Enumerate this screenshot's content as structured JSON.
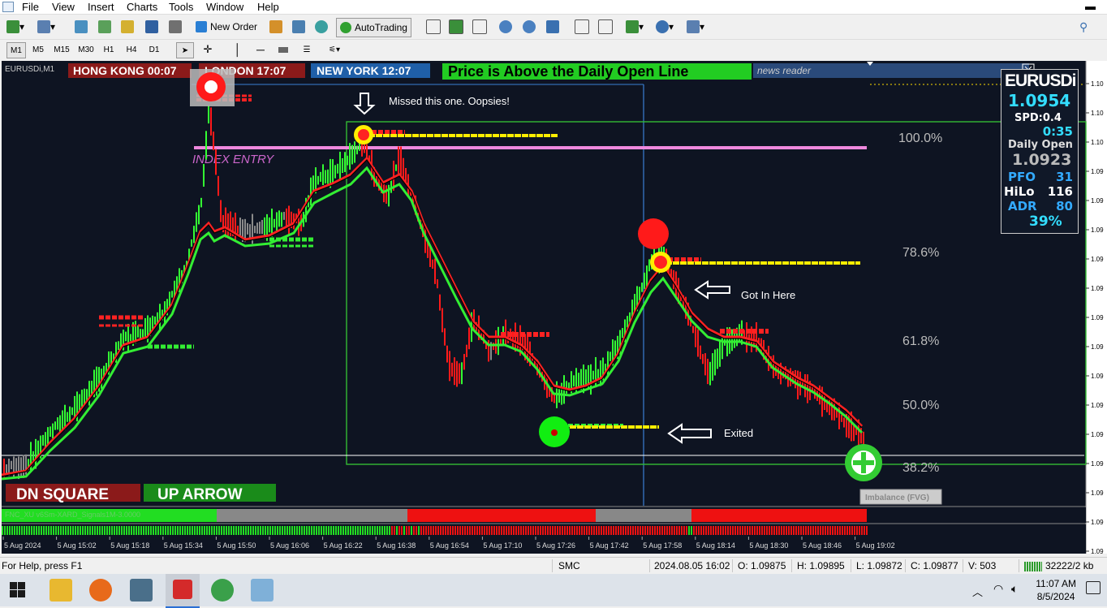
{
  "menu": [
    "File",
    "View",
    "Insert",
    "Charts",
    "Tools",
    "Window",
    "Help"
  ],
  "toolbar": {
    "new_order": "New Order",
    "auto_trading": "AutoTrading"
  },
  "timeframes": [
    "M1",
    "M5",
    "M15",
    "M30",
    "H1",
    "H4",
    "D1"
  ],
  "active_timeframe": "M1",
  "chart": {
    "symbol_tab": "EURUSDi,M1",
    "sessions": [
      {
        "label": "HONG KONG 00:07",
        "color": "#8b1a1a"
      },
      {
        "label": "LONDON  17:07",
        "color": "#8b1a1a"
      },
      {
        "label": "NEW YORK  12:07",
        "color": "#1f5fa8"
      }
    ],
    "banner": "Price is Above the Daily Open Line",
    "news_reader": "news reader",
    "index_entry": "INDEX ENTRY",
    "annotations": {
      "missed": "Missed this one.  Oopsies!",
      "got_in": "Got In Here",
      "exited": "Exited"
    },
    "fib_levels": [
      "100.0%",
      "78.6%",
      "61.8%",
      "50.0%",
      "38.2%"
    ],
    "signals": {
      "dn": "DN SQUARE",
      "up": "UP ARROW"
    },
    "imbalance": "Imbalance (FVG)",
    "indicator_label": "FNC_XU v6Sm-XARD_Signals1M-3.0000",
    "price_axis": [
      "1.10",
      "1.10",
      "1.10",
      "1.09",
      "1.09",
      "1.09",
      "1.09",
      "1.09",
      "1.09",
      "1.09",
      "1.09",
      "1.09",
      "1.09",
      "1.09",
      "1.09",
      "1.09",
      "1.09"
    ],
    "time_axis": [
      "5 Aug 2024",
      "5 Aug 15:02",
      "5 Aug 15:18",
      "5 Aug 15:34",
      "5 Aug 15:50",
      "5 Aug 16:06",
      "5 Aug 16:22",
      "5 Aug 16:38",
      "5 Aug 16:54",
      "5 Aug 17:10",
      "5 Aug 17:26",
      "5 Aug 17:42",
      "5 Aug 17:58",
      "5 Aug 18:14",
      "5 Aug 18:30",
      "5 Aug 18:46",
      "5 Aug 19:02"
    ]
  },
  "info_panel": {
    "symbol": "EURUSDi",
    "price": "1.0954",
    "spread": "SPD:0.4",
    "timer": "0:35",
    "daily_open_label": "Daily Open",
    "daily_open": "1.0923",
    "pfo_label": "PFO",
    "pfo": "31",
    "hilo_label": "HiLo",
    "hilo": "116",
    "adr_label": "ADR",
    "adr": "80",
    "pct": "39%"
  },
  "status": {
    "help": "For Help, press F1",
    "profile": "SMC",
    "datetime": "2024.08.05 16:02",
    "open": "O: 1.09875",
    "high": "H: 1.09895",
    "low": "L: 1.09872",
    "close": "C: 1.09877",
    "volume": "V: 503",
    "traffic": "32222/2 kb"
  },
  "taskbar": {
    "time": "11:07 AM",
    "date": "8/5/2024"
  },
  "colors": {
    "chart_bg": "#0e1422",
    "bull": "#33ff33",
    "bear": "#ff1a1a",
    "neutral": "#8a8a8a",
    "fib": "#cccccc",
    "banner_green": "#22cc22",
    "info_cyan": "#33ddff"
  }
}
